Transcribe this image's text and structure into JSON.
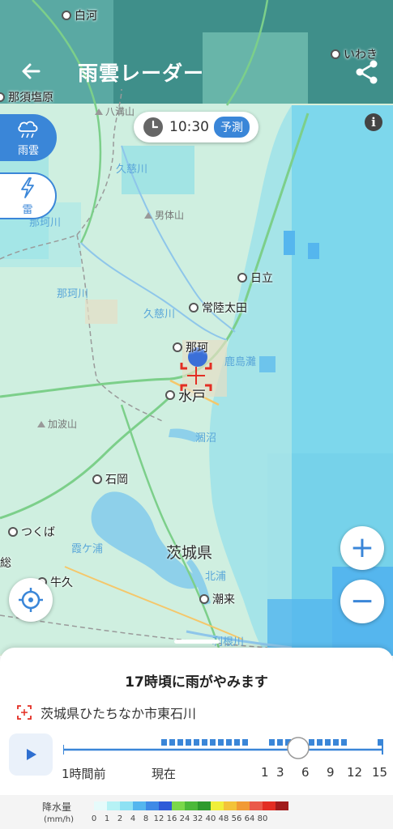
{
  "header": {
    "title": "雨雲レーダー",
    "back_icon": "back-arrow-icon",
    "share_icon": "share-icon"
  },
  "time_pill": {
    "time": "10:30",
    "badge": "予測"
  },
  "side_tabs": [
    {
      "label": "雨雲",
      "icon": "rain-cloud-icon",
      "selected": true
    },
    {
      "label": "雷",
      "icon": "lightning-icon",
      "selected": false
    }
  ],
  "map": {
    "places": [
      {
        "name": "白河"
      },
      {
        "name": "いわき"
      },
      {
        "name": "那須塩原"
      },
      {
        "name": "日立"
      },
      {
        "name": "常陸太田"
      },
      {
        "name": "那珂"
      },
      {
        "name": "水戸"
      },
      {
        "name": "石岡"
      },
      {
        "name": "つくば"
      },
      {
        "name": "牛久"
      },
      {
        "name": "潮来"
      },
      {
        "name": "総"
      }
    ],
    "rivers": [
      "久慈川",
      "那珂川",
      "那珂川",
      "久慈川",
      "霞ケ浦",
      "北浦",
      "利根川",
      "鹿島灘",
      "涸沼"
    ],
    "mountains": [
      "八溝山",
      "男体山",
      "加波山"
    ],
    "prefecture": "茨城県"
  },
  "zoom": {
    "in": "+",
    "out": "−"
  },
  "sheet": {
    "message": "17時頃に雨がやみます",
    "location": "茨城県ひたちなか市東石川",
    "timeline_labels": [
      "1時間前",
      "現在",
      "1",
      "3",
      "6",
      "9",
      "12",
      "15"
    ]
  },
  "legend": {
    "title": "降水量",
    "unit": "(mm/h)",
    "values": [
      "0",
      "1",
      "2",
      "4",
      "8",
      "12",
      "16",
      "24",
      "32",
      "40",
      "48",
      "56",
      "64",
      "80"
    ],
    "colors": [
      "#e6fbfb",
      "#b6f2f5",
      "#8ee1f3",
      "#55b6ee",
      "#3f8ae6",
      "#2f5bd8",
      "#7bd84a",
      "#4cb93a",
      "#2e9a2d",
      "#f0ef3a",
      "#f3c33a",
      "#f19a36",
      "#ea5a4a",
      "#e32e23",
      "#a11c1c"
    ]
  },
  "colors": {
    "accent": "#3a86d8",
    "header_tint": "#2d8f91"
  }
}
